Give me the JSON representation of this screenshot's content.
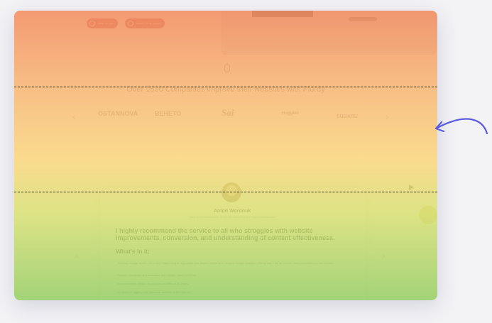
{
  "hero": {
    "buttons": [
      {
        "label": "Start for free"
      },
      {
        "label": "Install Perdy plugin"
      }
    ]
  },
  "companies": {
    "title": "Over 1500 Companies improve their websites with Plerdy",
    "logos": [
      "OSTANNOVA",
      "BEHETO",
      "Sai",
      "Huggies",
      "SUBARU"
    ]
  },
  "testimonial": {
    "name": "Anton Woronuk",
    "role": "Head of the department of internet marketing and digital development",
    "quote": "I highly recommend the service to all who struggles with website improvements, conversion, and understanding of content effectiveness.",
    "whats_in_it": "What's in it:",
    "bullets": [
      "Tracking of page scrolls. It's a very useful thing for big pages and always problems to setup in Google Analytics (Plerdy has it all) as well as sales are phased by the function.",
      "Register conditions and heatmaps from mobile, share perfectly.",
      "Any convenient division by sources of traffic on all pages.",
      "An option of tagging and presence statistics of the tags etc."
    ]
  },
  "colors": {
    "heat_top": "#f28c5f",
    "heat_mid": "#f9d478",
    "heat_bottom": "#96cd64",
    "arrow": "#5b5be0"
  }
}
